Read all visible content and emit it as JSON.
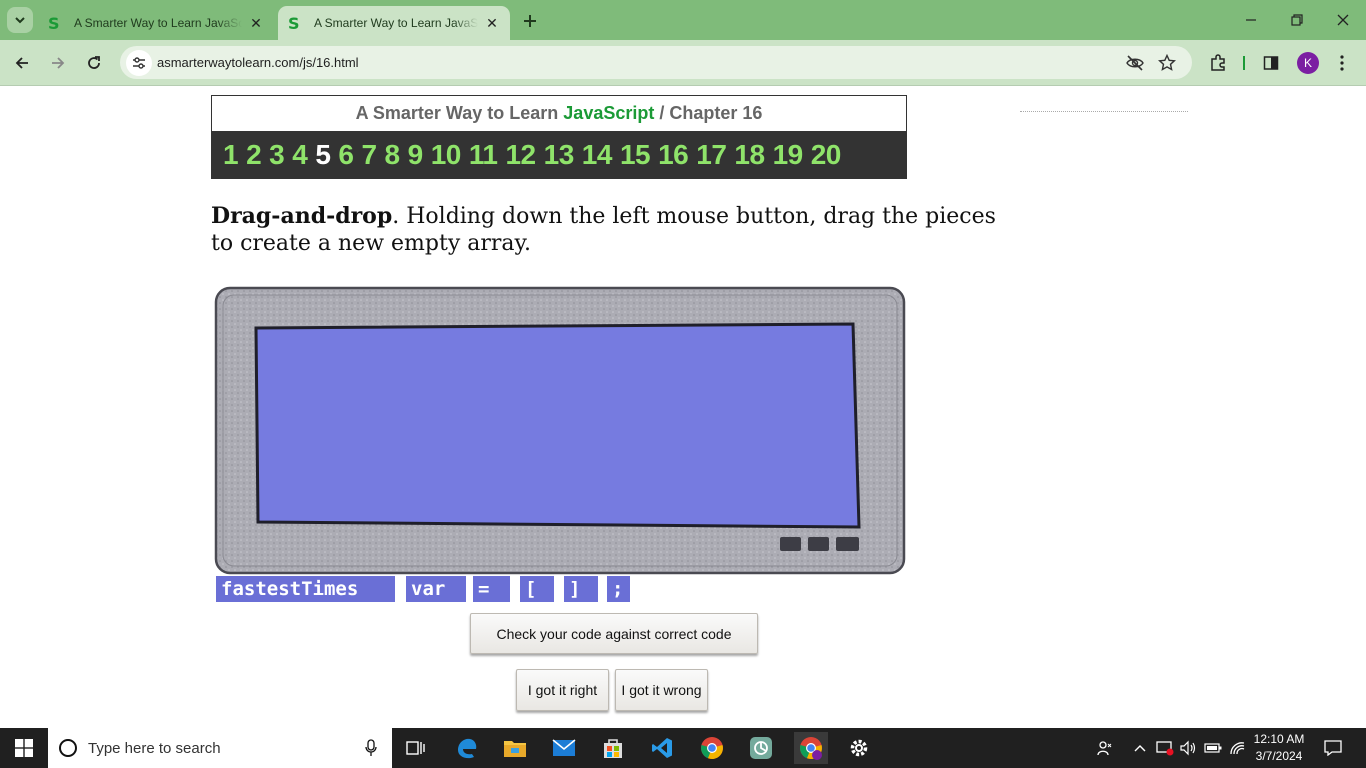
{
  "browser": {
    "tabs": [
      {
        "favicon": "S",
        "title": "A Smarter Way to Learn JavaScript",
        "active": false
      },
      {
        "favicon": "S",
        "title": "A Smarter Way to Learn JavaScript",
        "active": true
      }
    ],
    "url": "asmarterwaytolearn.com/js/16.html",
    "profile_initial": "K"
  },
  "page": {
    "header": {
      "prefix": "A Smarter Way to Learn ",
      "brand": "JavaScript",
      "separator": " / ",
      "chapter": "Chapter 16"
    },
    "chapters": [
      "1",
      "2",
      "3",
      "4",
      "5",
      "6",
      "7",
      "8",
      "9",
      "10",
      "11",
      "12",
      "13",
      "14",
      "15",
      "16",
      "17",
      "18",
      "19",
      "20"
    ],
    "current_chapter": "5",
    "instructions": {
      "bold": "Drag-and-drop",
      "text": ". Holding down the left mouse button, drag the pieces to create a new empty array."
    },
    "pieces": [
      "fastestTimes",
      "var",
      "=",
      "[",
      "]",
      ";"
    ],
    "check_button": "Check your code against correct code",
    "right_button": "I got it right",
    "wrong_button": "I got it wrong"
  },
  "taskbar": {
    "search_placeholder": "Type here to search",
    "time": "12:10 AM",
    "date": "3/7/2024"
  },
  "colors": {
    "tabbar": "#7fbb7a",
    "toolbar": "#cbe3c6",
    "chapter_link": "#8fe36a",
    "brand_green": "#1b9a36",
    "piece_bg": "#6a6fd6",
    "screen": "#7a7fe0"
  }
}
